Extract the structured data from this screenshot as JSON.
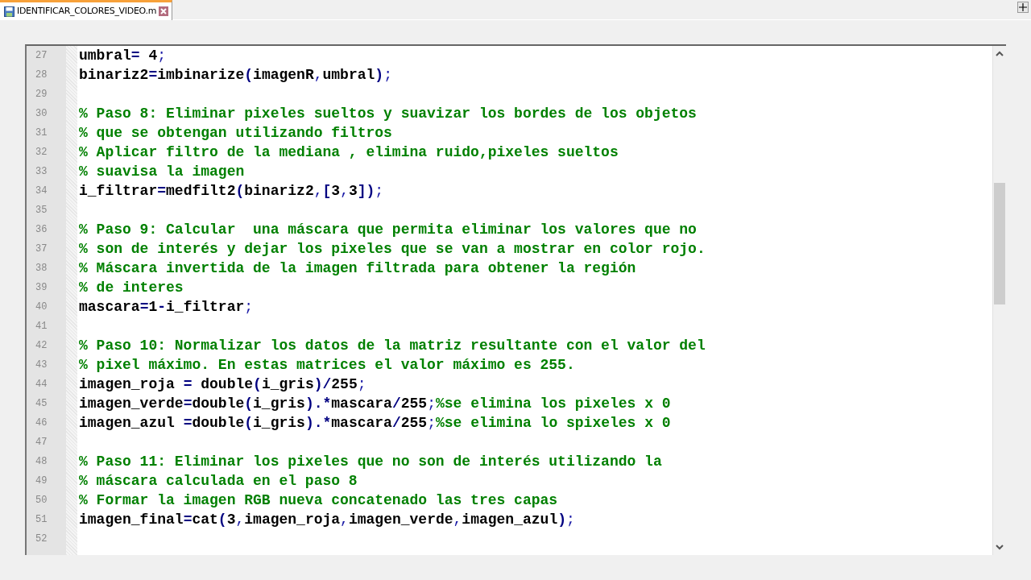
{
  "tabs": [
    {
      "label": "IDENTIFICAR_COLORES_VIDEO.m",
      "selected": true
    }
  ],
  "lines": [
    {
      "number": "27",
      "tokens": [
        {
          "kind": "text",
          "text": "umbral"
        },
        {
          "kind": "op",
          "text": "="
        },
        {
          "kind": "text",
          "text": " 4"
        },
        {
          "kind": "punct",
          "text": ";"
        }
      ]
    },
    {
      "number": "28",
      "tokens": [
        {
          "kind": "text",
          "text": "binariz2"
        },
        {
          "kind": "op",
          "text": "="
        },
        {
          "kind": "text",
          "text": "imbinarize"
        },
        {
          "kind": "op",
          "text": "("
        },
        {
          "kind": "text",
          "text": "imagenR"
        },
        {
          "kind": "punct",
          "text": ","
        },
        {
          "kind": "text",
          "text": "umbral"
        },
        {
          "kind": "op",
          "text": ")"
        },
        {
          "kind": "punct",
          "text": ";"
        }
      ]
    },
    {
      "number": "29"
    },
    {
      "number": "30",
      "tokens": [
        {
          "kind": "comment",
          "text": "% Paso 8: Eliminar pixeles sueltos y suavizar los bordes de los objetos"
        }
      ]
    },
    {
      "number": "31",
      "tokens": [
        {
          "kind": "comment",
          "text": "% que se obtengan utilizando filtros"
        }
      ]
    },
    {
      "number": "32",
      "tokens": [
        {
          "kind": "comment",
          "text": "% Aplicar filtro de la mediana , elimina ruido,pixeles sueltos"
        }
      ]
    },
    {
      "number": "33",
      "tokens": [
        {
          "kind": "comment",
          "text": "% suavisa la imagen"
        }
      ]
    },
    {
      "number": "34",
      "tokens": [
        {
          "kind": "text",
          "text": "i_filtrar"
        },
        {
          "kind": "op",
          "text": "="
        },
        {
          "kind": "text",
          "text": "medfilt2"
        },
        {
          "kind": "op",
          "text": "("
        },
        {
          "kind": "text",
          "text": "binariz2"
        },
        {
          "kind": "punct",
          "text": ","
        },
        {
          "kind": "op",
          "text": "["
        },
        {
          "kind": "text",
          "text": "3"
        },
        {
          "kind": "punct",
          "text": ","
        },
        {
          "kind": "text",
          "text": "3"
        },
        {
          "kind": "op",
          "text": "])"
        },
        {
          "kind": "punct",
          "text": ";"
        }
      ]
    },
    {
      "number": "35"
    },
    {
      "number": "36",
      "tokens": [
        {
          "kind": "comment",
          "text": "% Paso 9: Calcular  una máscara que permita eliminar los valores que no"
        }
      ]
    },
    {
      "number": "37",
      "tokens": [
        {
          "kind": "comment",
          "text": "% son de interés y dejar los pixeles que se van a mostrar en color rojo."
        }
      ]
    },
    {
      "number": "38",
      "tokens": [
        {
          "kind": "comment",
          "text": "% Máscara invertida de la imagen filtrada para obtener la región"
        }
      ]
    },
    {
      "number": "39",
      "tokens": [
        {
          "kind": "comment",
          "text": "% de interes"
        }
      ]
    },
    {
      "number": "40",
      "tokens": [
        {
          "kind": "text",
          "text": "mascara"
        },
        {
          "kind": "op",
          "text": "="
        },
        {
          "kind": "text",
          "text": "1"
        },
        {
          "kind": "op",
          "text": "-"
        },
        {
          "kind": "text",
          "text": "i_filtrar"
        },
        {
          "kind": "punct",
          "text": ";"
        }
      ]
    },
    {
      "number": "41"
    },
    {
      "number": "42",
      "tokens": [
        {
          "kind": "comment",
          "text": "% Paso 10: Normalizar los datos de la matriz resultante con el valor del"
        }
      ]
    },
    {
      "number": "43",
      "tokens": [
        {
          "kind": "comment",
          "text": "% pixel máximo. En estas matrices el valor máximo es 255."
        }
      ]
    },
    {
      "number": "44",
      "tokens": [
        {
          "kind": "text",
          "text": "imagen_roja "
        },
        {
          "kind": "op",
          "text": "="
        },
        {
          "kind": "text",
          "text": " double"
        },
        {
          "kind": "op",
          "text": "("
        },
        {
          "kind": "text",
          "text": "i_gris"
        },
        {
          "kind": "op",
          "text": ")/"
        },
        {
          "kind": "text",
          "text": "255"
        },
        {
          "kind": "punct",
          "text": ";"
        }
      ]
    },
    {
      "number": "45",
      "tokens": [
        {
          "kind": "text",
          "text": "imagen_verde"
        },
        {
          "kind": "op",
          "text": "="
        },
        {
          "kind": "text",
          "text": "double"
        },
        {
          "kind": "op",
          "text": "("
        },
        {
          "kind": "text",
          "text": "i_gris"
        },
        {
          "kind": "op",
          "text": ")"
        },
        {
          "kind": "op",
          "text": ".*"
        },
        {
          "kind": "text",
          "text": "mascara"
        },
        {
          "kind": "op",
          "text": "/"
        },
        {
          "kind": "text",
          "text": "255"
        },
        {
          "kind": "punct",
          "text": ";"
        },
        {
          "kind": "comment",
          "text": "%se elimina los pixeles x 0"
        }
      ]
    },
    {
      "number": "46",
      "tokens": [
        {
          "kind": "text",
          "text": "imagen_azul "
        },
        {
          "kind": "op",
          "text": "="
        },
        {
          "kind": "text",
          "text": "double"
        },
        {
          "kind": "op",
          "text": "("
        },
        {
          "kind": "text",
          "text": "i_gris"
        },
        {
          "kind": "op",
          "text": ")"
        },
        {
          "kind": "op",
          "text": ".*"
        },
        {
          "kind": "text",
          "text": "mascara"
        },
        {
          "kind": "op",
          "text": "/"
        },
        {
          "kind": "text",
          "text": "255"
        },
        {
          "kind": "punct",
          "text": ";"
        },
        {
          "kind": "comment",
          "text": "%se elimina lo spixeles x 0"
        }
      ]
    },
    {
      "number": "47"
    },
    {
      "number": "48",
      "tokens": [
        {
          "kind": "comment",
          "text": "% Paso 11: Eliminar los pixeles que no son de interés utilizando la"
        }
      ]
    },
    {
      "number": "49",
      "tokens": [
        {
          "kind": "comment",
          "text": "% máscara calculada en el paso 8"
        }
      ]
    },
    {
      "number": "50",
      "tokens": [
        {
          "kind": "comment",
          "text": "% Formar la imagen RGB nueva concatenado las tres capas"
        }
      ]
    },
    {
      "number": "51",
      "tokens": [
        {
          "kind": "text",
          "text": "imagen_final"
        },
        {
          "kind": "op",
          "text": "="
        },
        {
          "kind": "text",
          "text": "cat"
        },
        {
          "kind": "op",
          "text": "("
        },
        {
          "kind": "text",
          "text": "3"
        },
        {
          "kind": "punct",
          "text": ","
        },
        {
          "kind": "text",
          "text": "imagen_roja"
        },
        {
          "kind": "punct",
          "text": ","
        },
        {
          "kind": "text",
          "text": "imagen_verde"
        },
        {
          "kind": "punct",
          "text": ","
        },
        {
          "kind": "text",
          "text": "imagen_azul"
        },
        {
          "kind": "op",
          "text": ")"
        },
        {
          "kind": "punct",
          "text": ";"
        }
      ]
    },
    {
      "number": "52"
    }
  ]
}
